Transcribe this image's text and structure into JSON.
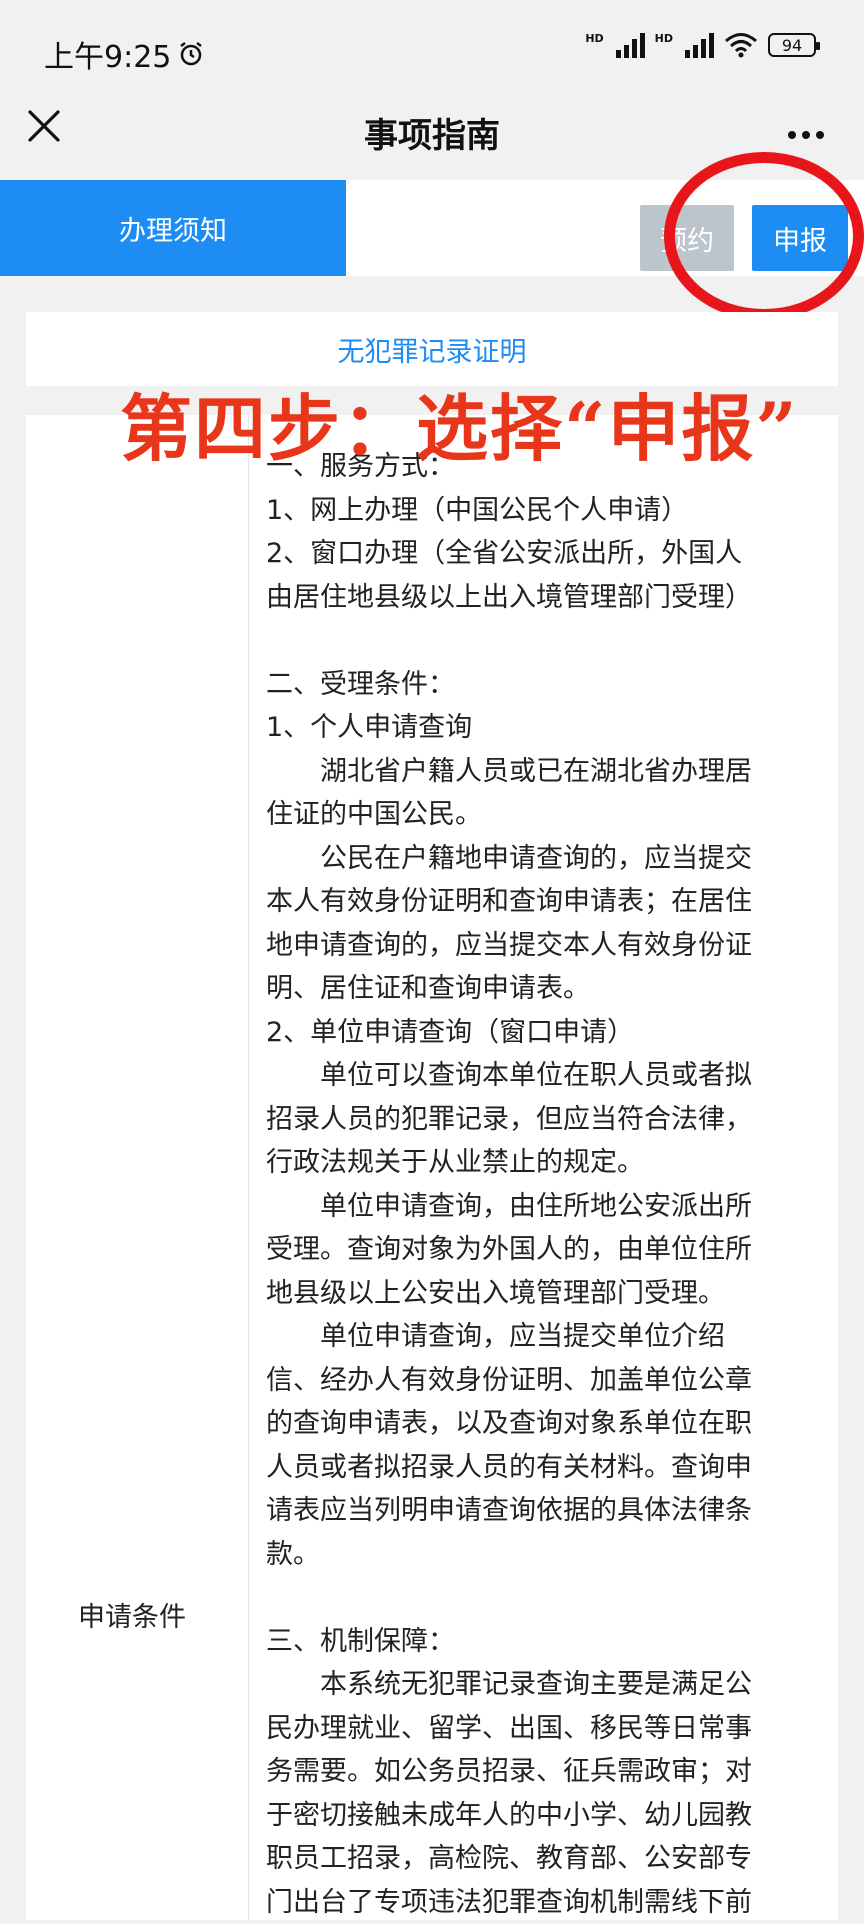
{
  "status_bar": {
    "time": "上午9:25",
    "battery": "94",
    "network_label_1": "HD",
    "network_label_2": "HD"
  },
  "header": {
    "title": "事项指南"
  },
  "tabs": {
    "active_label": "办理须知",
    "reserve_label": "预约",
    "apply_label": "申报"
  },
  "item_name": "无犯罪记录证明",
  "annotation_text": "第四步：选择“申报”",
  "conditions": {
    "label": "申请条件",
    "lines": [
      {
        "text": "一、服务方式：",
        "indent": false
      },
      {
        "text": "1、网上办理（中国公民个人申请）",
        "indent": false
      },
      {
        "text": "2、窗口办理（全省公安派出所，外国人",
        "indent": false
      },
      {
        "text": "由居住地县级以上出入境管理部门受理）",
        "indent": false
      },
      {
        "text": "",
        "indent": false
      },
      {
        "text": "二、受理条件：",
        "indent": false
      },
      {
        "text": "1、个人申请查询",
        "indent": false
      },
      {
        "text": "湖北省户籍人员或已在湖北省办理居",
        "indent": true
      },
      {
        "text": "住证的中国公民。",
        "indent": false
      },
      {
        "text": "公民在户籍地申请查询的，应当提交",
        "indent": true
      },
      {
        "text": "本人有效身份证明和查询申请表；在居住",
        "indent": false
      },
      {
        "text": "地申请查询的，应当提交本人有效身份证",
        "indent": false
      },
      {
        "text": "明、居住证和查询申请表。",
        "indent": false
      },
      {
        "text": "2、单位申请查询（窗口申请）",
        "indent": false
      },
      {
        "text": "单位可以查询本单位在职人员或者拟",
        "indent": true
      },
      {
        "text": "招录人员的犯罪记录，但应当符合法律，",
        "indent": false
      },
      {
        "text": "行政法规关于从业禁止的规定。",
        "indent": false
      },
      {
        "text": "单位申请查询，由住所地公安派出所",
        "indent": true
      },
      {
        "text": "受理。查询对象为外国人的，由单位住所",
        "indent": false
      },
      {
        "text": "地县级以上公安出入境管理部门受理。",
        "indent": false
      },
      {
        "text": "单位申请查询，应当提交单位介绍",
        "indent": true
      },
      {
        "text": "信、经办人有效身份证明、加盖单位公章",
        "indent": false
      },
      {
        "text": "的查询申请表，以及查询对象系单位在职",
        "indent": false
      },
      {
        "text": "人员或者拟招录人员的有关材料。查询申",
        "indent": false
      },
      {
        "text": "请表应当列明申请查询依据的具体法律条",
        "indent": false
      },
      {
        "text": "款。",
        "indent": false
      },
      {
        "text": "",
        "indent": false
      },
      {
        "text": "三、机制保障：",
        "indent": false
      },
      {
        "text": "本系统无犯罪记录查询主要是满足公",
        "indent": true
      },
      {
        "text": "民办理就业、留学、出国、移民等日常事",
        "indent": false
      },
      {
        "text": "务需要。如公务员招录、征兵需政审；对",
        "indent": false
      },
      {
        "text": "于密切接触未成年人的中小学、幼儿园教",
        "indent": false
      },
      {
        "text": "职员工招录，高检院、教育部、公安部专",
        "indent": false
      },
      {
        "text": "门出台了专项违法犯罪查询机制需线下前",
        "indent": false
      }
    ]
  }
}
